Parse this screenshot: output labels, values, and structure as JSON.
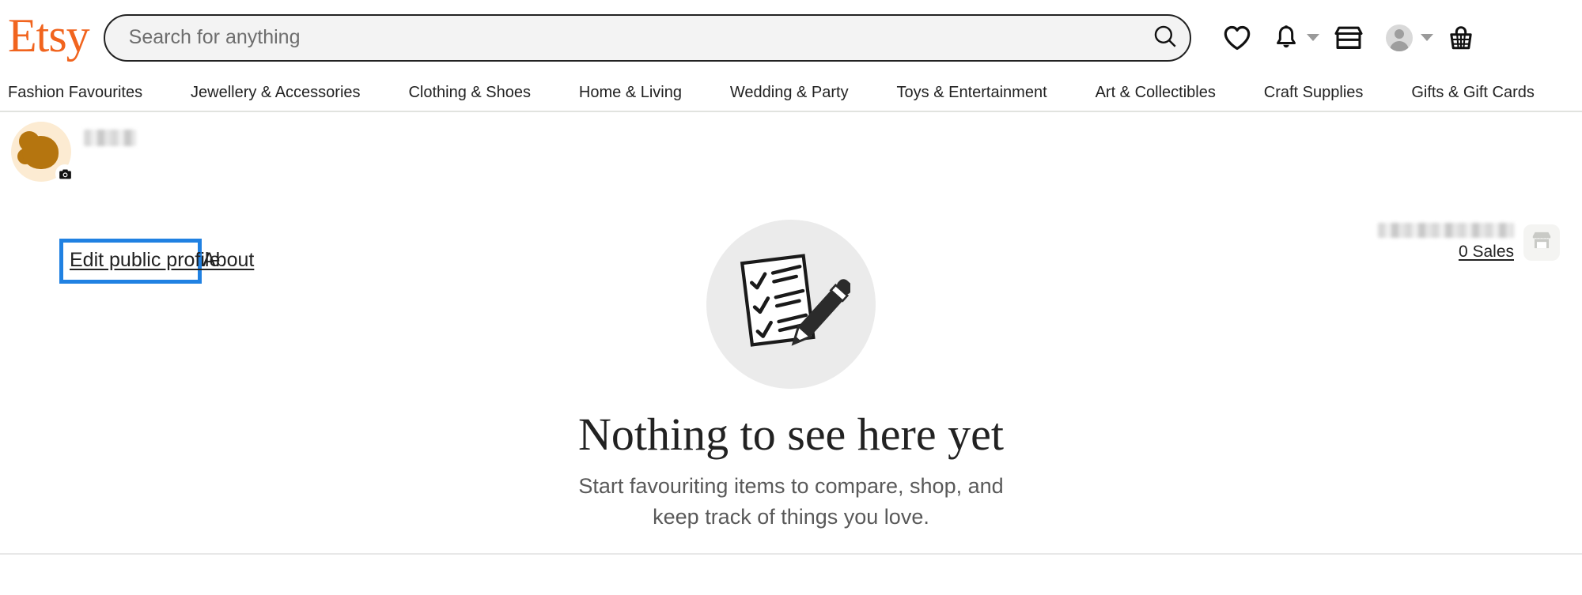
{
  "header": {
    "logo_text": "Etsy",
    "logo_color": "#F1641E",
    "search": {
      "value": "",
      "placeholder": "Search for anything",
      "icon": "search-icon"
    },
    "icons": [
      {
        "name": "favourites-icon",
        "glyph": "heart"
      },
      {
        "name": "notifications-icon",
        "glyph": "bell",
        "has_caret": true
      },
      {
        "name": "shop-manager-icon",
        "glyph": "storefront"
      },
      {
        "name": "account-avatar-icon",
        "glyph": "avatar",
        "has_caret": true
      },
      {
        "name": "cart-icon",
        "glyph": "basket"
      }
    ]
  },
  "nav": {
    "items": [
      {
        "label": "Fashion Favourites"
      },
      {
        "label": "Jewellery & Accessories"
      },
      {
        "label": "Clothing & Shoes"
      },
      {
        "label": "Home & Living"
      },
      {
        "label": "Wedding & Party"
      },
      {
        "label": "Toys & Entertainment"
      },
      {
        "label": "Art & Collectibles"
      },
      {
        "label": "Craft Supplies"
      },
      {
        "label": "Gifts & Gift Cards"
      }
    ]
  },
  "profile": {
    "avatar_name": "user-avatar",
    "avatar_bg_color": "#FCEBD2",
    "avatar_shape_color": "#B5750F",
    "camera_badge_icon": "camera-icon",
    "username_redacted": true,
    "edit_profile_label": "Edit public profile",
    "about_label": "About",
    "highlight_color": "#2081E2",
    "highlighted_element": "Edit public profile"
  },
  "shop": {
    "shop_name_redacted": true,
    "sales_label": "0 Sales",
    "sales_count": 0,
    "tile_icon": "storefront-icon"
  },
  "empty_state": {
    "illustration_icon": "checklist-pencil-icon",
    "illustration_bg_color": "#EBEBEB",
    "title": "Nothing to see here yet",
    "subtitle": "Start favouriting items to compare, shop, and keep track of things you love."
  }
}
